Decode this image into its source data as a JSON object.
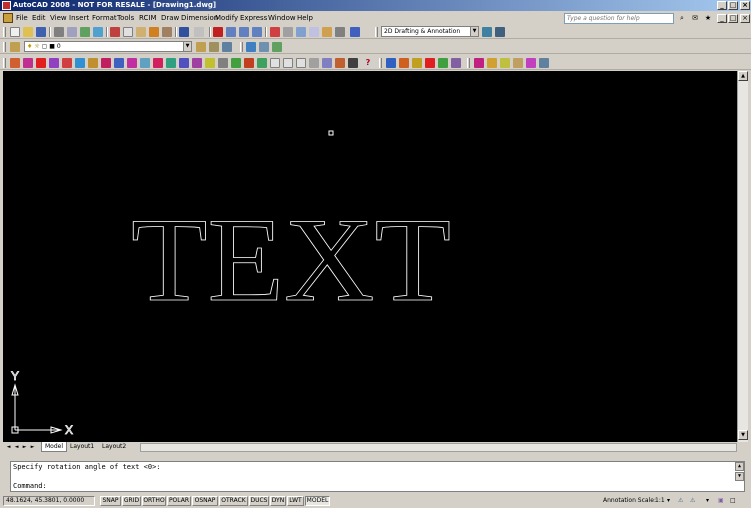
{
  "window": {
    "title": "AutoCAD 2008 - NOT FOR RESALE - [Drawing1.dwg]"
  },
  "menu": {
    "items": [
      "File",
      "Edit",
      "View",
      "Insert",
      "Format",
      "Tools",
      "RCIM",
      "Draw",
      "Dimension",
      "Modify",
      "Express",
      "Window",
      "Help"
    ]
  },
  "help_search": {
    "placeholder": "Type a question for help"
  },
  "toolbar": {
    "workspace": "2D Drafting & Annotation",
    "layer_name": "0"
  },
  "drawing": {
    "text": "TEXT",
    "ucs_x_label": "X",
    "ucs_y_label": "Y"
  },
  "layout_tabs": [
    "Model",
    "Layout1",
    "Layout2"
  ],
  "command": {
    "history": "Specify rotation angle of text <0>:",
    "prompt": "Command:"
  },
  "status": {
    "coordinates": "48.1624, 45.3801, 0.0000",
    "toggles": [
      "SNAP",
      "GRID",
      "ORTHO",
      "POLAR",
      "OSNAP",
      "OTRACK",
      "DUCS",
      "DYN",
      "LWT",
      "MODEL"
    ],
    "annotation_scale_label": "Annotation Scale:",
    "annotation_scale_value": "1:1"
  },
  "colors": {
    "canvas": "#000000",
    "chrome": "#d4d0c8",
    "title_gradient_start": "#0a246a",
    "title_gradient_end": "#a6caf0"
  }
}
